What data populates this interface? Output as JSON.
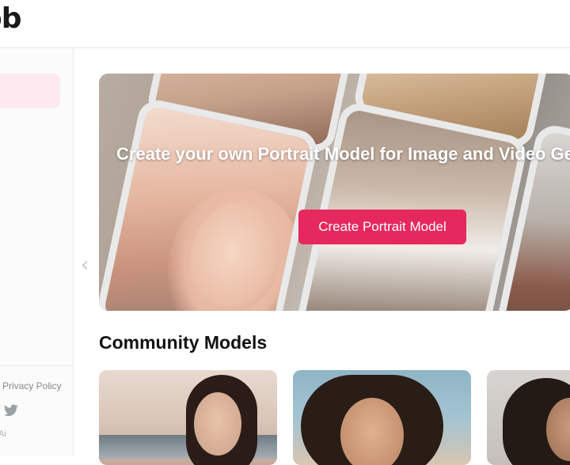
{
  "header": {
    "logo_text": "ob"
  },
  "sidebar": {
    "footer_link": "Privacy Policy",
    "social_icon": "twitter-icon",
    "misc_text": "Ai"
  },
  "hero": {
    "title": "Create your own Portrait Model for Image and Video Generation!",
    "button_label": "Create Portrait Model",
    "accent_color": "#e5285d"
  },
  "carousel": {
    "prev_icon": "chevron-left-icon",
    "prev_glyph": "‹"
  },
  "community": {
    "title": "Community Models"
  }
}
